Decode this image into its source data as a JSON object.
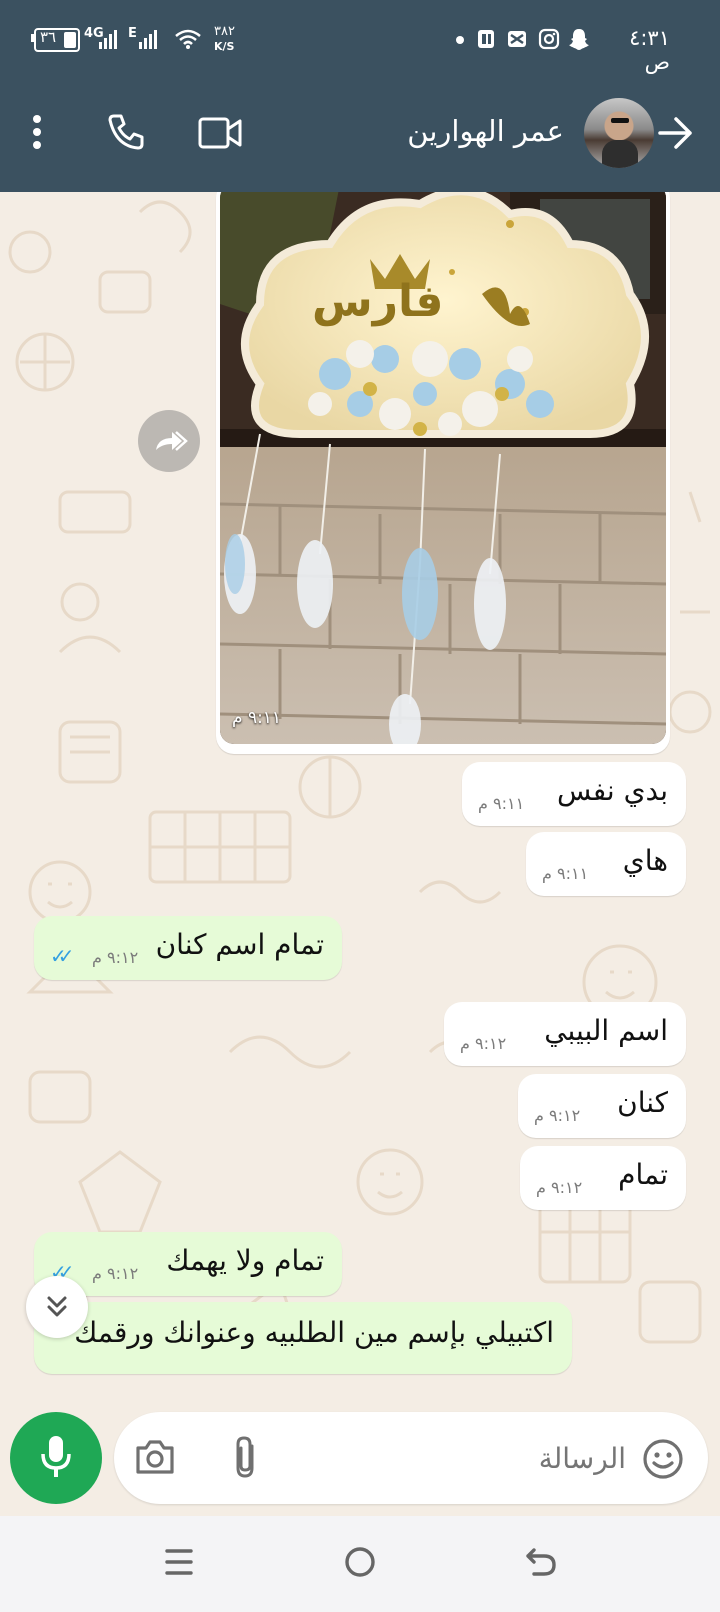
{
  "status_bar": {
    "time": "٤:٣١ ص",
    "battery": "٣٦",
    "network": "4G",
    "network2": "E",
    "speed_value": "٣٨٢",
    "speed_unit": "K/S"
  },
  "header": {
    "contact_name": "عمر الهوارين"
  },
  "image_message": {
    "time": "٩:١١ م",
    "sign_text": "فارس"
  },
  "messages": [
    {
      "text": "بدي نفس",
      "time": "٩:١١ م",
      "direction": "in"
    },
    {
      "text": "هاي",
      "time": "٩:١١ م",
      "direction": "in"
    },
    {
      "text": "تمام اسم كنان",
      "time": "٩:١٢ م",
      "direction": "out"
    },
    {
      "text": "اسم البيبي",
      "time": "٩:١٢ م",
      "direction": "in"
    },
    {
      "text": "كنان",
      "time": "٩:١٢ م",
      "direction": "in"
    },
    {
      "text": "تمام",
      "time": "٩:١٢ م",
      "direction": "in"
    },
    {
      "text": "تمام ولا يهمك",
      "time": "٩:١٢ م",
      "direction": "out"
    },
    {
      "text": "اكتبيلي بإسم مين الطلبيه وعنوانك ورقمك",
      "time": "",
      "direction": "out"
    }
  ],
  "composer": {
    "placeholder": "الرسالة"
  },
  "colors": {
    "header_bg": "#3b5160",
    "chat_bg": "#f4ede4",
    "outgoing_bubble": "#e6fbd7",
    "incoming_bubble": "#ffffff",
    "accent_green": "#1fa855",
    "read_ticks": "#34a0e0"
  },
  "icons": [
    "more-vert-icon",
    "phone-icon",
    "video-call-icon",
    "back-arrow-icon",
    "forward-icon",
    "camera-icon",
    "attach-icon",
    "emoji-icon",
    "mic-icon",
    "scroll-down-icon",
    "menu-nav-icon",
    "home-nav-icon",
    "back-nav-icon"
  ]
}
